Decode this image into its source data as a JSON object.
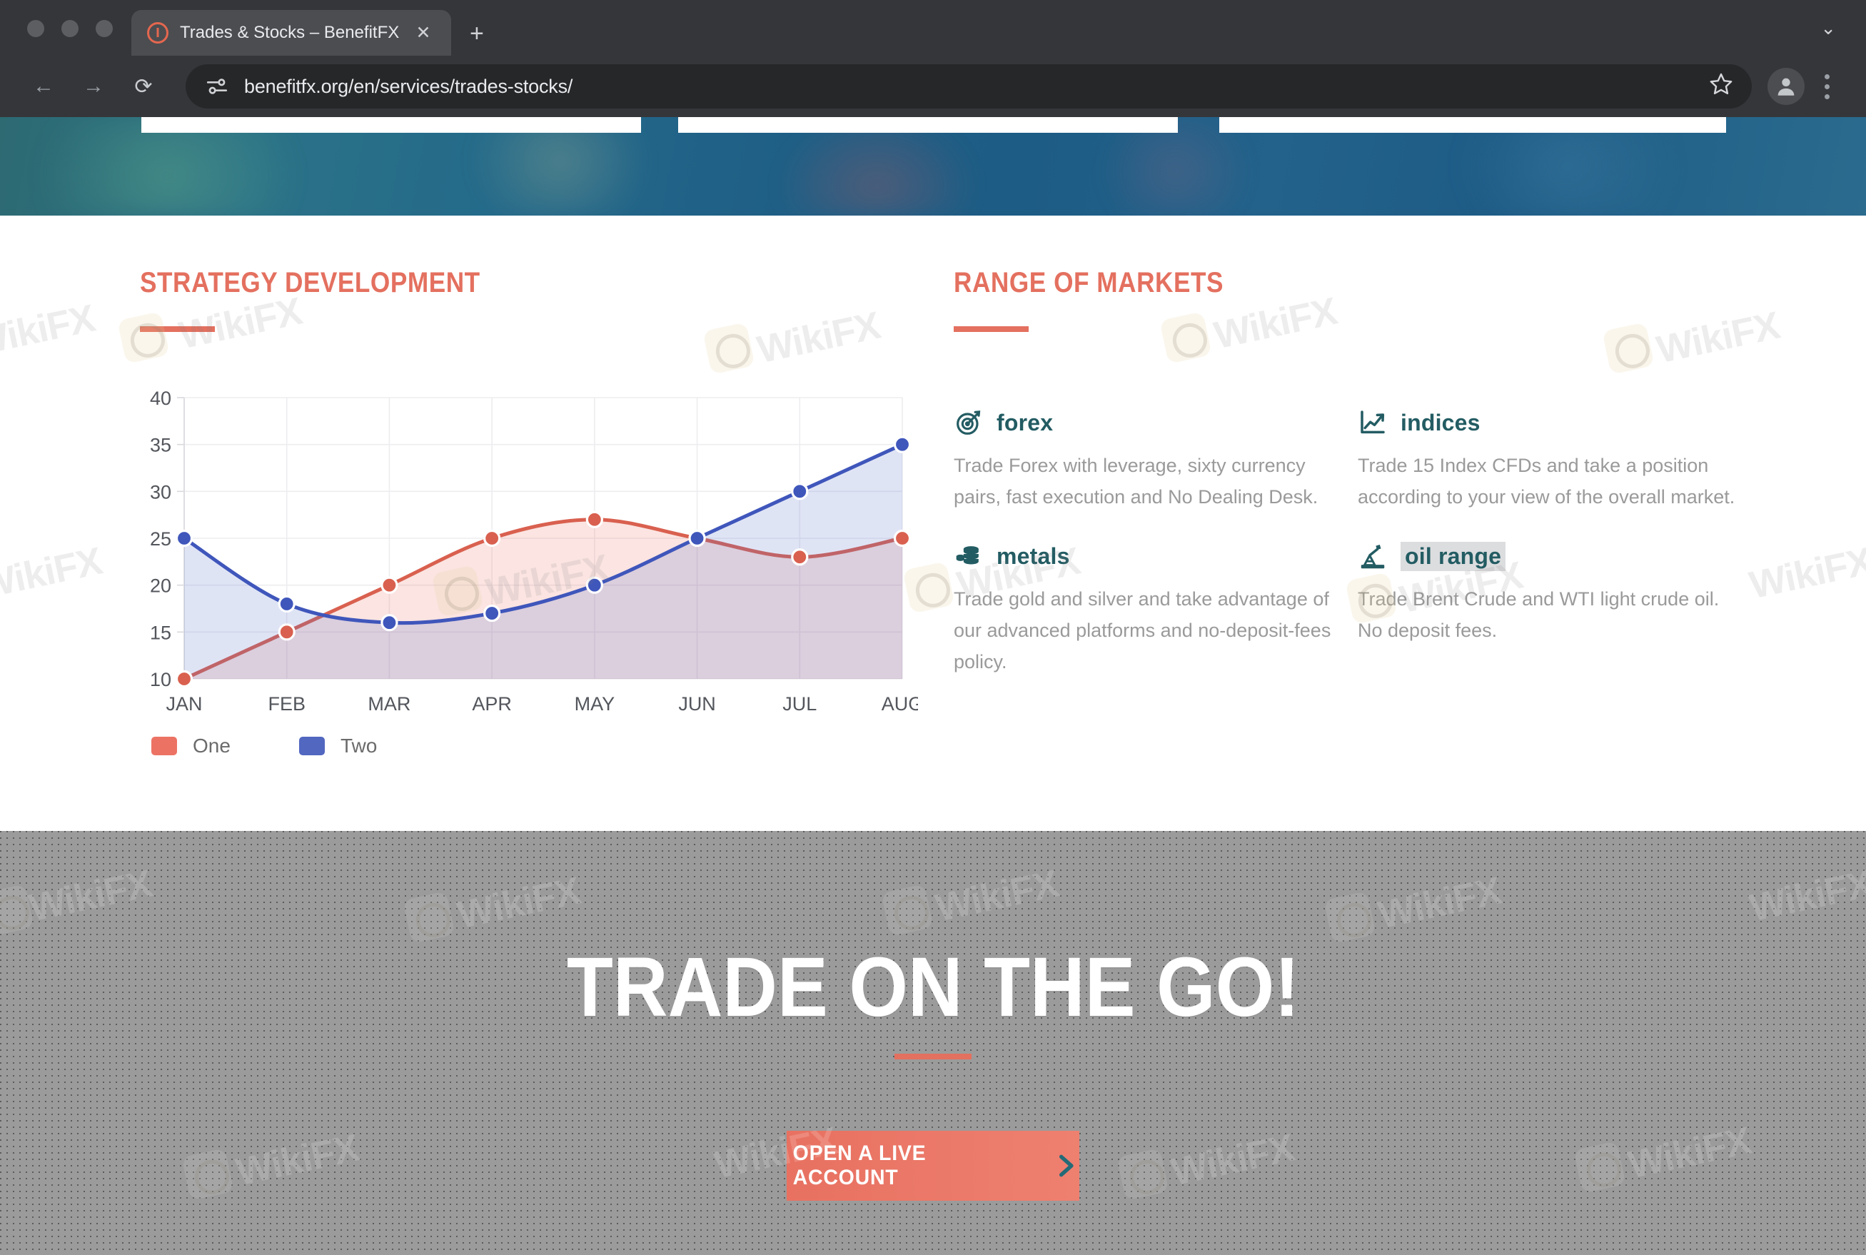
{
  "browser": {
    "window_controls": [
      "close",
      "minimize",
      "maximize"
    ],
    "tab": {
      "title": "Trades & Stocks – BenefitFX",
      "favicon": "warning-circle-icon",
      "close_label": "✕"
    },
    "new_tab_label": "+",
    "tab_list_chevron": "⌄",
    "nav": {
      "back": "←",
      "forward": "→",
      "reload": "⟳"
    },
    "omnibox": {
      "url": "benefitfx.org/en/services/trades-stocks/",
      "site_info_icon": "tune-icon",
      "bookmark_icon": "star-icon"
    },
    "profile_icon": "account-icon",
    "menu_icon": "three-dot-menu-icon"
  },
  "page": {
    "strategy": {
      "heading": "STRATEGY DEVELOPMENT",
      "legend": [
        {
          "label": "One",
          "color": "#ec7364"
        },
        {
          "label": "Two",
          "color": "#5267c0"
        }
      ]
    },
    "markets": {
      "heading": "RANGE OF MARKETS",
      "items": [
        {
          "icon": "target-dart-icon",
          "name": "forex",
          "selected": false,
          "description": "Trade Forex with leverage, sixty currency pairs, fast execution and No Dealing Desk."
        },
        {
          "icon": "line-chart-up-icon",
          "name": "indices",
          "selected": false,
          "description": "Trade 15 Index CFDs and take a position according to your view of the overall market."
        },
        {
          "icon": "coin-stack-icon",
          "name": "metals",
          "selected": false,
          "description": "Trade gold and silver and take advantage of our advanced platforms and no-deposit-fees policy."
        },
        {
          "icon": "oil-pumpjack-icon",
          "name": "oil range",
          "selected": true,
          "description": "Trade Brent Crude and WTI light crude oil. No deposit fees."
        }
      ]
    },
    "cta": {
      "title": "TRADE ON THE GO!",
      "button_label": "OPEN A LIVE ACCOUNT",
      "button_chevron": "chevron-right-icon",
      "button_color": "#e87161",
      "chevron_color": "#246a77"
    },
    "accent_color": "#e4705f",
    "market_name_color": "#235c63",
    "watermark_text": "WikiFX"
  },
  "chart_data": {
    "type": "area",
    "title": "",
    "xlabel": "",
    "ylabel": "",
    "categories": [
      "JAN",
      "FEB",
      "MAR",
      "APR",
      "MAY",
      "JUN",
      "JUL",
      "AUG"
    ],
    "ylim": [
      10,
      40
    ],
    "yticks": [
      10,
      15,
      20,
      25,
      30,
      35,
      40
    ],
    "grid": true,
    "legend_position": "bottom-left",
    "smoothing": "spline",
    "markers": true,
    "series": [
      {
        "name": "One",
        "color": "#d9604f",
        "fill": "rgba(233,120,105,0.20)",
        "values": [
          10,
          15,
          20,
          25,
          27,
          25,
          23,
          25
        ]
      },
      {
        "name": "Two",
        "color": "#3f56bb",
        "fill": "rgba(95,120,205,0.20)",
        "values": [
          25,
          18,
          16,
          17,
          20,
          25,
          30,
          35
        ]
      }
    ]
  }
}
